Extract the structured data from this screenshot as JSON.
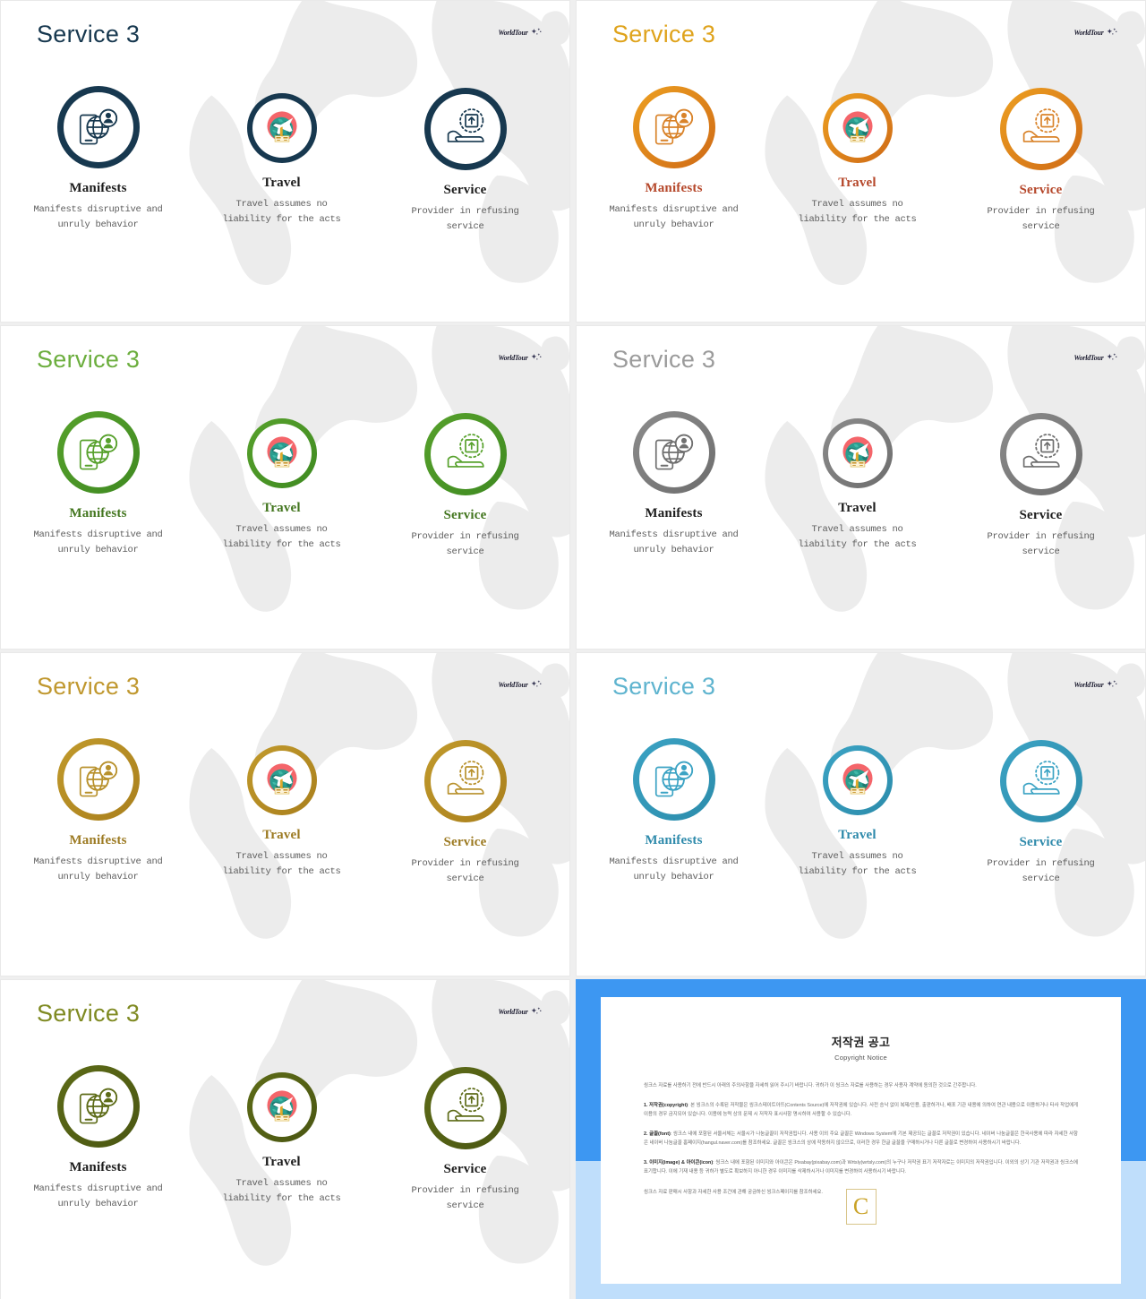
{
  "theme_colors": {
    "navy": "#17384f",
    "orange": "#e8951d",
    "orange_dark": "#cf6a16",
    "orange_heading": "#b5472a",
    "green": "#4c9a2a",
    "green_title": "#6cae3e",
    "gray": "#7c7c7c",
    "gray_title": "#9b9b9b",
    "gold": "#b8912c",
    "gold_title": "#c0982f",
    "teal": "#3ba3c4",
    "teal_title": "#5fb4cf",
    "olive": "#5d6b17",
    "olive_title": "#7f8a22",
    "text_dark": "#1c1c1c",
    "text_body": "#5d5d5d",
    "map_gray": "#ececec",
    "copy_blue": "#3d97f2",
    "copy_blue_light": "#bfdefb"
  },
  "logo": {
    "text": "WorldTour",
    "icon": "sparkle-icon"
  },
  "slides": [
    {
      "id": "slide-navy",
      "title": "Service 3",
      "title_color": "#17384f",
      "ring_color": "#17384f",
      "ring_color2": "#17384f",
      "icon_color": "#17384f",
      "heading_color": "#1c1c1c",
      "items": [
        {
          "icon": "mobile-globe-user-icon",
          "head": "Manifests",
          "desc": "Manifests disruptive and unruly behavior"
        },
        {
          "icon": "globe-airplane-ticket-icon",
          "head": "Travel",
          "desc": "Travel assumes no liability for the acts"
        },
        {
          "icon": "hand-upload-box-icon",
          "head": "Service",
          "desc": "Provider in refusing service"
        }
      ]
    },
    {
      "id": "slide-orange",
      "title": "Service 3",
      "title_color": "#dfa31c",
      "ring_color": "#eda021",
      "ring_color2": "#cf6a16",
      "icon_color": "#d9832a",
      "heading_color": "#b5472a",
      "items": [
        {
          "icon": "mobile-globe-user-icon",
          "head": "Manifests",
          "desc": "Manifests disruptive and unruly behavior"
        },
        {
          "icon": "globe-airplane-ticket-icon",
          "head": "Travel",
          "desc": "Travel assumes no liability for the acts"
        },
        {
          "icon": "hand-upload-box-icon",
          "head": "Service",
          "desc": "Provider in refusing service"
        }
      ]
    },
    {
      "id": "slide-green",
      "title": "Service 3",
      "title_color": "#6cae3e",
      "ring_color": "#57a12c",
      "ring_color2": "#3f8a21",
      "icon_color": "#57a12c",
      "heading_color": "#43761f",
      "items": [
        {
          "icon": "mobile-globe-user-icon",
          "head": "Manifests",
          "desc": "Manifests disruptive and unruly behavior"
        },
        {
          "icon": "globe-airplane-ticket-icon",
          "head": "Travel",
          "desc": "Travel assumes no liability for the acts"
        },
        {
          "icon": "hand-upload-box-icon",
          "head": "Service",
          "desc": "Provider in refusing service"
        }
      ]
    },
    {
      "id": "slide-gray",
      "title": "Service 3",
      "title_color": "#9b9b9b",
      "ring_color": "#8c8c8c",
      "ring_color2": "#6d6d6d",
      "icon_color": "#6f6f6f",
      "heading_color": "#1c1c1c",
      "items": [
        {
          "icon": "mobile-globe-user-icon",
          "head": "Manifests",
          "desc": "Manifests disruptive and unruly behavior"
        },
        {
          "icon": "globe-airplane-ticket-icon",
          "head": "Travel",
          "desc": "Travel assumes no liability for the acts"
        },
        {
          "icon": "hand-upload-box-icon",
          "head": "Service",
          "desc": "Provider in refusing service"
        }
      ]
    },
    {
      "id": "slide-gold",
      "title": "Service 3",
      "title_color": "#c0982f",
      "ring_color": "#c19a2c",
      "ring_color2": "#a97f1c",
      "icon_color": "#b8912c",
      "heading_color": "#9c7a22",
      "items": [
        {
          "icon": "mobile-globe-user-icon",
          "head": "Manifests",
          "desc": "Manifests disruptive and unruly behavior"
        },
        {
          "icon": "globe-airplane-ticket-icon",
          "head": "Travel",
          "desc": "Travel assumes no liability for the acts"
        },
        {
          "icon": "hand-upload-box-icon",
          "head": "Service",
          "desc": "Provider in refusing service"
        }
      ]
    },
    {
      "id": "slide-teal",
      "title": "Service 3",
      "title_color": "#5fb4cf",
      "ring_color": "#3ba3c4",
      "ring_color2": "#2c8cab",
      "icon_color": "#3ba3c4",
      "heading_color": "#2e8aab",
      "items": [
        {
          "icon": "mobile-globe-user-icon",
          "head": "Manifests",
          "desc": "Manifests disruptive and unruly behavior"
        },
        {
          "icon": "globe-airplane-ticket-icon",
          "head": "Travel",
          "desc": "Travel assumes no liability for the acts"
        },
        {
          "icon": "hand-upload-box-icon",
          "head": "Service",
          "desc": "Provider in refusing service"
        }
      ]
    },
    {
      "id": "slide-olive",
      "title": "Service 3",
      "title_color": "#7f8a22",
      "ring_color": "#5d6b17",
      "ring_color2": "#4a5612",
      "icon_color": "#5d6b17",
      "heading_color": "#1c1c1c",
      "items": [
        {
          "icon": "mobile-globe-user-icon",
          "head": "Manifests",
          "desc": "Manifests disruptive and unruly behavior"
        },
        {
          "icon": "globe-airplane-ticket-icon",
          "head": "Travel",
          "desc": "Travel assumes no liability for the acts"
        },
        {
          "icon": "hand-upload-box-icon",
          "head": "Service",
          "desc": "Provider in refusing service"
        }
      ]
    }
  ],
  "copyright": {
    "title": "저작권 공고",
    "subtitle": "Copyright Notice",
    "watermark": "C",
    "intro": "씽크스 자료를 사용하기 전에 반드시 아래의 주의사항을 자세히 읽어 주시기 바랍니다. 귀하가 이 씽크스 자료를 사용하는 경우 사용자 계약에 동의한 것으로 간주합니다.",
    "sections": [
      {
        "label": "1. 저작권(copyright)",
        "text": ": 본 씽크스의 수록된 저작물은 씽크스테이트아뜨(Contents Source)에 저작권에 있습니다. 사전 승낙 없이 복제/인용, 출판하거나, 배포 기관 내용에 의하여 연관 내용으로 이용하거나 타사 작업에게 이용의 경우 금지되어 있습니다. 이용에 능력 상의 문제 시 저작자 표시사항 명시하여 사용할 수 있습니다."
      },
      {
        "label": "2. 글꼴(font)",
        "text": ": 씽크스 내에 포함된 서울서체는 서울시가 나눔글꼴이 저작권됩니다. 사용 이외 주요 글꼴은 Windows System에 기본 제공되는 글꼴로 저작권이 있습니다. 네이버 나눔글꼴은 한국사용에 따라 자세한 사항은 네이버 나눔글꼴 홈페이지(hangul.naver.com)를 참조하세요. 글꼴은 씽크스의 상에 작동하지 않으므로, 이러한 경우 한글 글꼴을 구매하시거나 다른 글꼴로 변경하여 사용하시기 바랍니다."
      },
      {
        "label": "3. 이미지(image) & 아이콘(icon)",
        "text": ": 씽크스 내에 포함된 이미지와 아이콘은 Pixabay(pixabay.com)과 Wrtsly(wrtsly.com)의 누구나 저작권 표기 저작자로는 이미지의 저작권입니다. 이외의 상기 기관 저작권과 씽크스에 표기합니다. 이에 기재 내용 등 귀하가 별도로 확보하지 아니한 경우 이미지를 삭제하시거나 이미지를 변경하여 사용하시기 바랍니다."
      }
    ],
    "footer": "씽크스 자료 판매시 사항과 자세한 사용 조건에 관해 궁금하신 씽크스페이지를 참조하세요."
  }
}
